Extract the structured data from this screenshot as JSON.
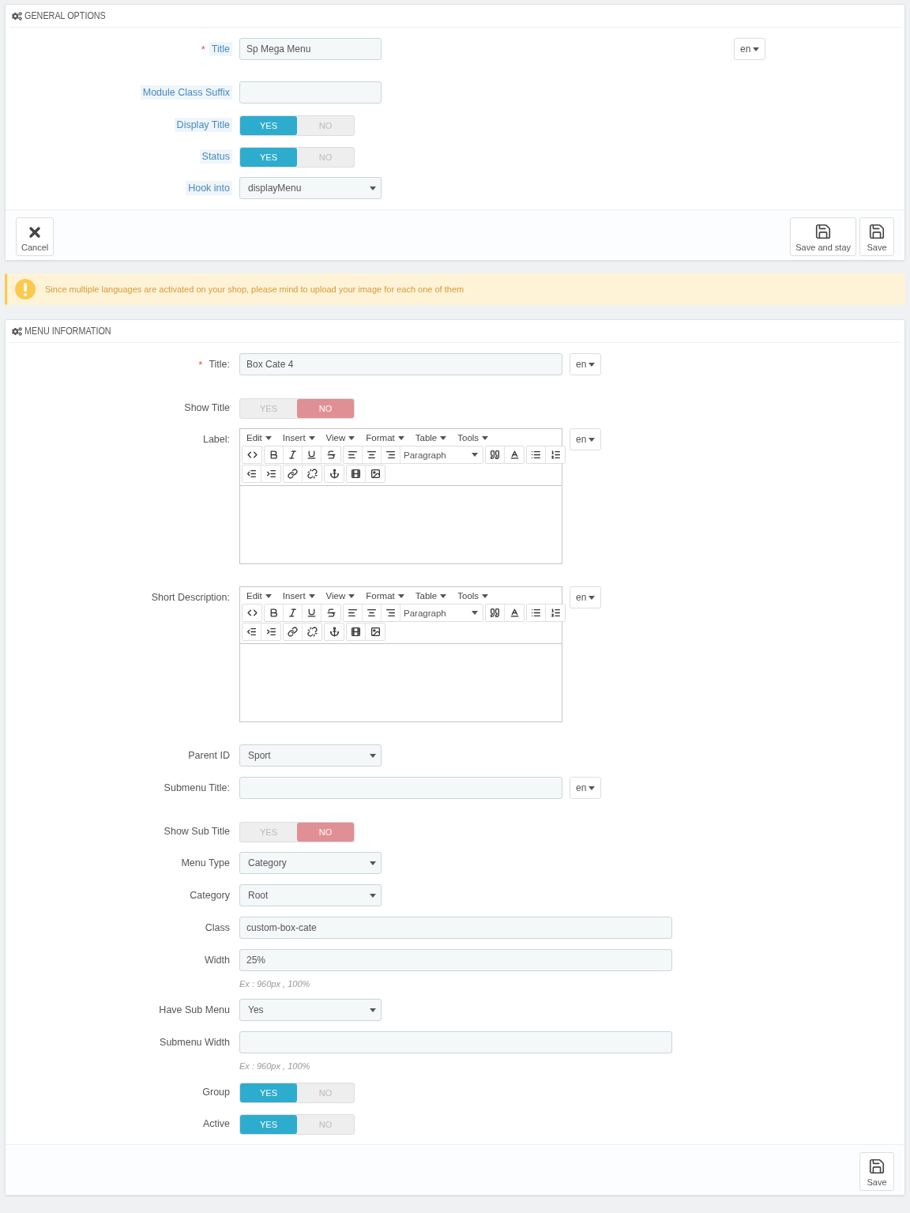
{
  "general_options": {
    "title": "GENERAL OPTIONS",
    "fields": [
      {
        "kind": "short_text",
        "label": "Title",
        "required_mark": "*",
        "tooltip": true,
        "value": "Sp Mega Menu",
        "lang": "en"
      },
      {
        "kind": "short_text",
        "label": "Module Class Suffix",
        "tooltip": true
      },
      {
        "kind": "toggle",
        "label": "Display Title",
        "tooltip": true,
        "options": [
          "YES",
          "NO"
        ],
        "on": true
      },
      {
        "kind": "toggle",
        "label": "Status",
        "tooltip": true,
        "options": [
          "YES",
          "NO"
        ],
        "on": true
      },
      {
        "kind": "select",
        "label": "Hook into",
        "tooltip": true,
        "value": "displayMenu"
      }
    ],
    "footer": [
      {
        "kind": "cancel",
        "label": "Cancel"
      },
      {
        "kind": "save",
        "label": "Save and stay"
      },
      {
        "kind": "save",
        "label": "Save"
      }
    ]
  },
  "alert": {
    "text": "Since multiple languages are activated on your shop, please mind to upload your image for each one of them"
  },
  "menu_information": {
    "title": "MENU INFORMATION",
    "fields": [
      {
        "kind": "lang_text",
        "label": "Title:",
        "required_mark": "*",
        "tooltip": false,
        "value": "Box Cate 4",
        "lang": "en"
      },
      {
        "kind": "toggle",
        "label": "Show Title",
        "tooltip": false,
        "options": [
          "YES",
          "NO"
        ],
        "on": false
      },
      {
        "kind": "editor",
        "label": "Label:",
        "tooltip": false,
        "menus": [
          "Edit",
          "Insert",
          "View",
          "Format",
          "Table",
          "Tools"
        ],
        "block_format": "Paragraph",
        "lang": "en"
      },
      {
        "kind": "editor",
        "label": "Short Description:",
        "tooltip": false,
        "menus": [
          "Edit",
          "Insert",
          "View",
          "Format",
          "Table",
          "Tools"
        ],
        "block_format": "Paragraph",
        "lang": "en"
      },
      {
        "kind": "select",
        "label": "Parent ID",
        "tooltip": false,
        "value": "Sport"
      },
      {
        "kind": "lang_text",
        "label": "Submenu Title:",
        "tooltip": false,
        "lang": "en"
      },
      {
        "kind": "toggle",
        "label": "Show Sub Title",
        "tooltip": false,
        "options": [
          "YES",
          "NO"
        ],
        "on": false
      },
      {
        "kind": "select",
        "label": "Menu Type",
        "tooltip": false,
        "value": "Category"
      },
      {
        "kind": "select",
        "label": "Category",
        "tooltip": false,
        "value": "Root"
      },
      {
        "kind": "long_text",
        "label": "Class",
        "tooltip": false,
        "value": "custom-box-cate"
      },
      {
        "kind": "long_text",
        "label": "Width",
        "tooltip": false,
        "value": "25%",
        "hint": "Ex : 960px , 100%"
      },
      {
        "kind": "select",
        "label": "Have Sub Menu",
        "tooltip": false,
        "value": "Yes"
      },
      {
        "kind": "long_text",
        "label": "Submenu Width",
        "tooltip": false,
        "hint": "Ex : 960px , 100%"
      },
      {
        "kind": "toggle",
        "label": "Group",
        "tooltip": false,
        "options": [
          "YES",
          "NO"
        ],
        "on": true
      },
      {
        "kind": "toggle",
        "label": "Active",
        "tooltip": false,
        "options": [
          "YES",
          "NO"
        ],
        "on": true
      }
    ],
    "footer": [
      {
        "kind": "save",
        "label": "Save"
      }
    ]
  }
}
